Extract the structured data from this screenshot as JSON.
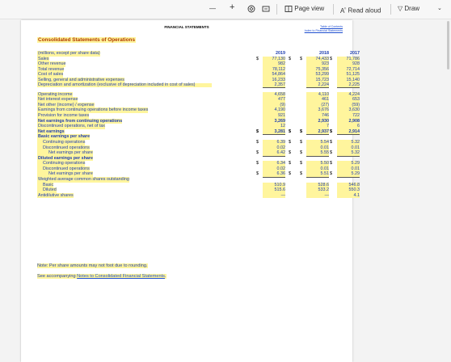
{
  "toolbar": {
    "minus": "—",
    "plus": "+",
    "page_view": "Page view",
    "read_aloud": "Read aloud",
    "draw": "Draw"
  },
  "page": {
    "header": "FINANCIAL STATEMENTS",
    "links": [
      "Table of Contents",
      "Index to Financial Statements"
    ],
    "title": "Consolidated Statements of Operations"
  },
  "table": {
    "header": {
      "label": "(millions, except per share data)",
      "y1": "2019",
      "y2": "2018",
      "y3": "2017"
    },
    "rows": [
      {
        "label": "Sales",
        "v": [
          "77,130",
          "74,433",
          "71,786"
        ],
        "dollar": true
      },
      {
        "label": "Other revenue",
        "v": [
          "982",
          "923",
          "928"
        ],
        "ul": true
      },
      {
        "label": "Total revenue",
        "v": [
          "78,112",
          "75,356",
          "72,714"
        ]
      },
      {
        "label": "Cost of sales",
        "v": [
          "54,864",
          "53,299",
          "51,125"
        ]
      },
      {
        "label": "Selling, general and administrative expenses",
        "v": [
          "16,233",
          "15,723",
          "15,140"
        ]
      },
      {
        "label": "Depreciation and amortization (exclusive of depreciation included in cost of sales)",
        "v": [
          "2,357",
          "2,224",
          "2,225"
        ],
        "dbl": true,
        "ul": true
      },
      {
        "label": "Operating income",
        "v": [
          "4,658",
          "4,110",
          "4,224"
        ]
      },
      {
        "label": "Net interest expense",
        "v": [
          "477",
          "461",
          "653"
        ]
      },
      {
        "label": "Net other (income) / expense",
        "v": [
          "(9)",
          "(27)",
          "(59)"
        ],
        "ul": true
      },
      {
        "label": "Earnings from continuing operations before income taxes",
        "v": [
          "4,190",
          "3,676",
          "3,630"
        ]
      },
      {
        "label": "Provision for income taxes",
        "v": [
          "921",
          "746",
          "722"
        ],
        "ul": true
      },
      {
        "label": "Net earnings from continuing operations",
        "v": [
          "3,269",
          "2,930",
          "2,908"
        ],
        "bold": true
      },
      {
        "label": "Discontinued operations, net of tax",
        "v": [
          "12",
          "7",
          "6"
        ],
        "ul": true
      },
      {
        "label": "Net earnings",
        "v": [
          "3,281",
          "2,937",
          "2,914"
        ],
        "bold": true,
        "dollar": true,
        "dul": true
      },
      {
        "label": "Basic earnings per share",
        "v": [
          "",
          "",
          ""
        ],
        "bold": true
      },
      {
        "label": "Continuing operations",
        "v": [
          "6.39",
          "5.54",
          "5.32"
        ],
        "dollar": true,
        "indent": 1
      },
      {
        "label": "Discontinued operations",
        "v": [
          "0.02",
          "0.01",
          "0.01"
        ],
        "indent": 1,
        "ul": true
      },
      {
        "label": "Net earnings per share",
        "v": [
          "6.42",
          "5.55",
          "5.32"
        ],
        "dollar": true,
        "indent": 2,
        "dul": true
      },
      {
        "label": "Diluted earnings per share",
        "v": [
          "",
          "",
          ""
        ],
        "bold": true
      },
      {
        "label": "Continuing operations",
        "v": [
          "6.34",
          "5.50",
          "5.29"
        ],
        "dollar": true,
        "indent": 1
      },
      {
        "label": "Discontinued operations",
        "v": [
          "0.02",
          "0.01",
          "0.01"
        ],
        "indent": 1,
        "ul": true
      },
      {
        "label": "Net earnings per share",
        "v": [
          "6.36",
          "5.51",
          "5.29"
        ],
        "dollar": true,
        "indent": 2,
        "dul": true
      },
      {
        "label": "Weighted average common shares outstanding",
        "v": [
          "",
          "",
          ""
        ]
      },
      {
        "label": "Basic",
        "v": [
          "510.9",
          "528.6",
          "546.8"
        ],
        "indent": 1
      },
      {
        "label": "Diluted",
        "v": [
          "515.6",
          "533.2",
          "550.3"
        ],
        "indent": 1
      },
      {
        "label": "Antidilutive shares",
        "v": [
          "—",
          "—",
          "4.1"
        ]
      }
    ]
  },
  "notes": {
    "rounding": "Note: Per share amounts may not foot due to rounding.",
    "see_prefix": "See accompanying ",
    "see_link": "Notes to Consolidated Financial Statements",
    "see_suffix": "."
  }
}
